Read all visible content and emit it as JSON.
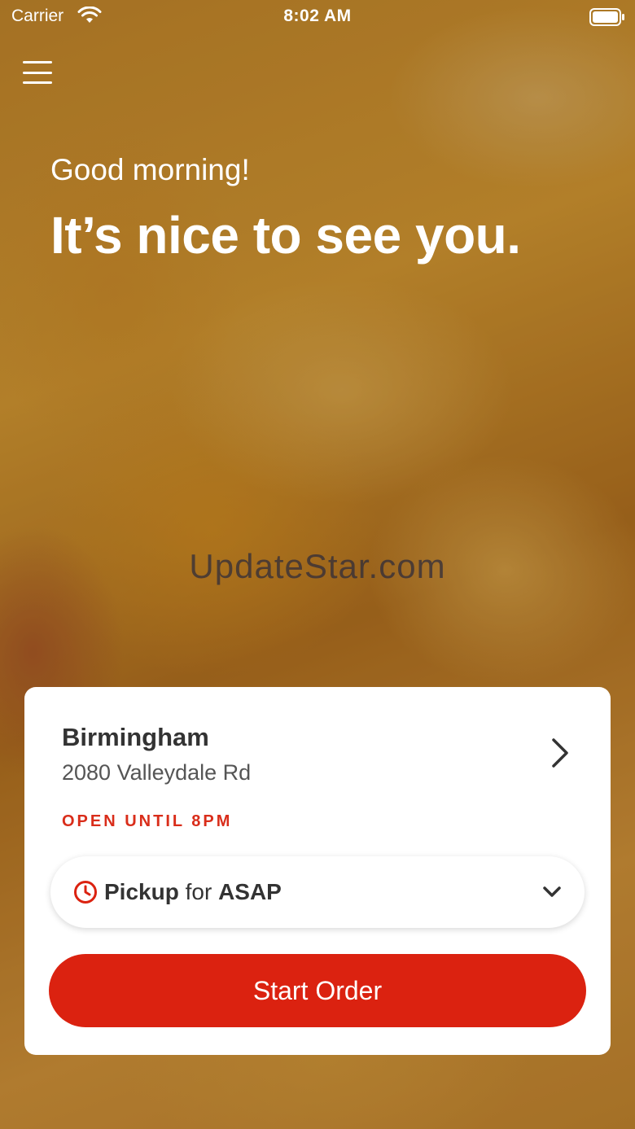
{
  "status_bar": {
    "carrier": "Carrier",
    "time": "8:02 AM"
  },
  "header": {
    "menu_icon": "hamburger-menu-icon"
  },
  "hero": {
    "greeting": "Good morning!",
    "headline": "It’s nice to see you."
  },
  "watermark": "UpdateStar.com",
  "location_card": {
    "name": "Birmingham",
    "address": "2080 Valleydale Rd",
    "hours": "OPEN UNTIL 8PM",
    "pickup": {
      "mode": "Pickup",
      "connector": "for",
      "time": "ASAP"
    },
    "start_order_label": "Start Order"
  },
  "colors": {
    "accent": "#db2210",
    "text_dark": "#333333",
    "text_muted": "#555555"
  },
  "icons": {
    "wifi": "wifi-icon",
    "battery": "battery-icon",
    "chevron_right": "chevron-right-icon",
    "clock": "clock-icon",
    "chevron_down": "chevron-down-icon"
  }
}
